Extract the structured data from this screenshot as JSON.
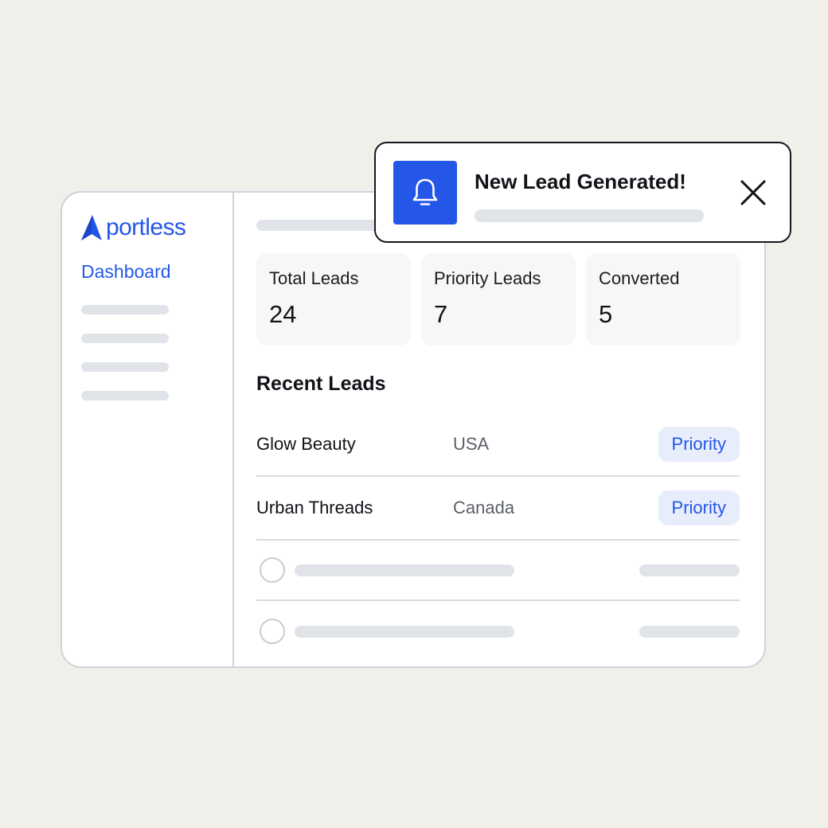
{
  "colors": {
    "background": "#f0efea",
    "brand": "#2457e8",
    "badge_bg": "#e8edfb",
    "skeleton": "#e0e3e8",
    "border": "#cfd2d8"
  },
  "sidebar": {
    "logo_text": "portless",
    "logo_icon": "portless-logo-icon",
    "active_item": "Dashboard"
  },
  "stats": [
    {
      "label": "Total Leads",
      "value": "24"
    },
    {
      "label": "Priority Leads",
      "value": "7"
    },
    {
      "label": "Converted",
      "value": "5"
    }
  ],
  "recent": {
    "title": "Recent Leads",
    "rows": [
      {
        "name": "Glow Beauty",
        "country": "USA",
        "badge": "Priority"
      },
      {
        "name": "Urban Threads",
        "country": "Canada",
        "badge": "Priority"
      }
    ]
  },
  "notification": {
    "title": "New Lead Generated!",
    "icon": "bell-icon",
    "close_icon": "close-icon"
  }
}
